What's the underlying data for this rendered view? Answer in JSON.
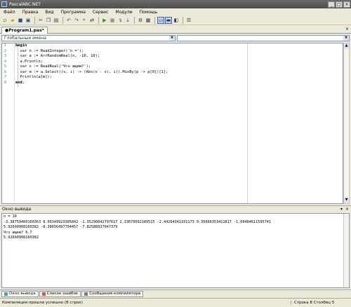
{
  "window": {
    "title": "PascalABC.NET"
  },
  "menu": [
    "Файл",
    "Правка",
    "Вид",
    "Программа",
    "Сервис",
    "Модули",
    "Помощь"
  ],
  "toolbar": {
    "icons": [
      "new-icon",
      "open-icon",
      "save-icon",
      "save-all-icon",
      "cut-icon",
      "copy-icon",
      "paste-icon",
      "undo-icon",
      "redo-icon",
      "find-icon",
      "replace-icon",
      "run-icon",
      "stop-icon",
      "step-over-icon",
      "step-into-icon",
      "debug-icon",
      "compile-icon",
      "layout-icon",
      "panel-icon",
      "toggle-icon",
      "settings-icon"
    ]
  },
  "document_tab": {
    "label": "●Program1.pas*",
    "close": "×"
  },
  "symbols_combo": {
    "value": "Глобальные имена",
    "second": ""
  },
  "editor": {
    "lines": [
      {
        "n": "1",
        "text": "begin"
      },
      {
        "n": "2",
        "text": "  var n := ReadInteger('n =');"
      },
      {
        "n": "3",
        "text": "  var a := ArrRandomReal(n, -10, 10);"
      },
      {
        "n": "4",
        "text": "  a.Println;"
      },
      {
        "n": "5",
        "text": "  var x := ReadReal('Что ищем?');"
      },
      {
        "n": "6",
        "text": "  var m := a.Select((v, i) -> (Abs(v - x), i)).MinBy(p -> p[0])[1];"
      },
      {
        "n": "7",
        "text": "  Println(a[m]);"
      },
      {
        "n": "8",
        "text": "end."
      }
    ]
  },
  "output_panel": {
    "title": "Окно вывода",
    "lines": [
      "n = 10",
      "-3.38759460160363 8.09349923305842 -1.35290642797617 2.33070092189515 -2.44264341101173 9.35666353411817 -1.09484611595741",
      "5.92690908160382 -8.38656497704457 -7.82588937047379",
      "Что ищем? 6.7",
      "5.92690908160382"
    ]
  },
  "bottom_tabs": [
    "Окно вывода",
    "Список ошибок",
    "Сообщения компилятора"
  ],
  "status": {
    "message": "Компиляция прошла успешно (8 строк)",
    "position": "Строка  8  Столбец  5"
  }
}
